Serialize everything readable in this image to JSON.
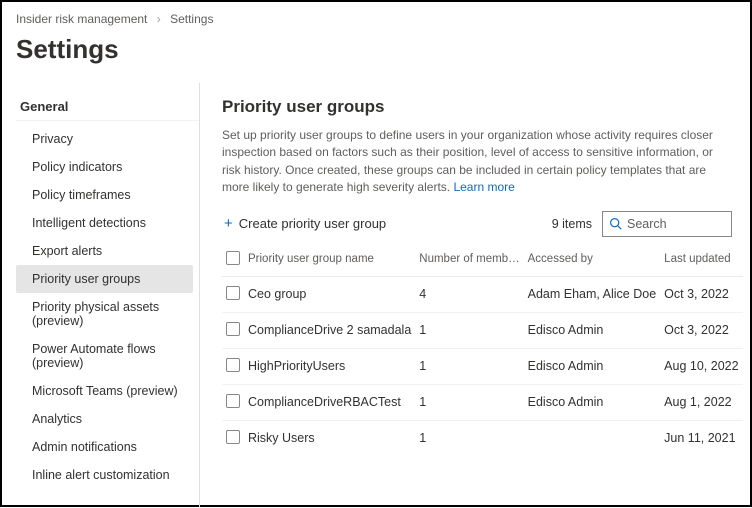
{
  "breadcrumb": {
    "root": "Insider risk management",
    "current": "Settings"
  },
  "page_title": "Settings",
  "sidebar": {
    "heading": "General",
    "items": [
      {
        "label": "Privacy",
        "selected": false
      },
      {
        "label": "Policy indicators",
        "selected": false
      },
      {
        "label": "Policy timeframes",
        "selected": false
      },
      {
        "label": "Intelligent detections",
        "selected": false
      },
      {
        "label": "Export alerts",
        "selected": false
      },
      {
        "label": "Priority user groups",
        "selected": true
      },
      {
        "label": "Priority physical assets (preview)",
        "selected": false
      },
      {
        "label": "Power Automate flows (preview)",
        "selected": false
      },
      {
        "label": "Microsoft Teams (preview)",
        "selected": false
      },
      {
        "label": "Analytics",
        "selected": false
      },
      {
        "label": "Admin notifications",
        "selected": false
      },
      {
        "label": "Inline alert customization",
        "selected": false
      }
    ]
  },
  "main": {
    "section_title": "Priority user groups",
    "description": "Set up priority user groups to define users in your organization whose activity requires closer inspection based on factors such as their position, level of access to sensitive information, or risk history. Once created, these groups can be included in certain policy templates that are more likely to generate high severity alerts. ",
    "learn_more": "Learn more",
    "create_label": "Create priority user group",
    "item_count": "9 items",
    "search_placeholder": "Search",
    "columns": {
      "name": "Priority user group name",
      "members": "Number of memb…",
      "accessed": "Accessed by",
      "updated": "Last updated"
    },
    "rows": [
      {
        "name": "Ceo group",
        "members": "4",
        "accessed": "Adam Eham, Alice Doe",
        "updated": "Oct 3, 2022"
      },
      {
        "name": "ComplianceDrive 2 samadala",
        "members": "1",
        "accessed": "Edisco Admin",
        "updated": "Oct 3, 2022"
      },
      {
        "name": "HighPriorityUsers",
        "members": "1",
        "accessed": "Edisco Admin",
        "updated": "Aug 10, 2022"
      },
      {
        "name": "ComplianceDriveRBACTest",
        "members": "1",
        "accessed": "Edisco Admin",
        "updated": "Aug 1, 2022"
      },
      {
        "name": "Risky Users",
        "members": "1",
        "accessed": "",
        "updated": "Jun 11, 2021"
      }
    ]
  }
}
